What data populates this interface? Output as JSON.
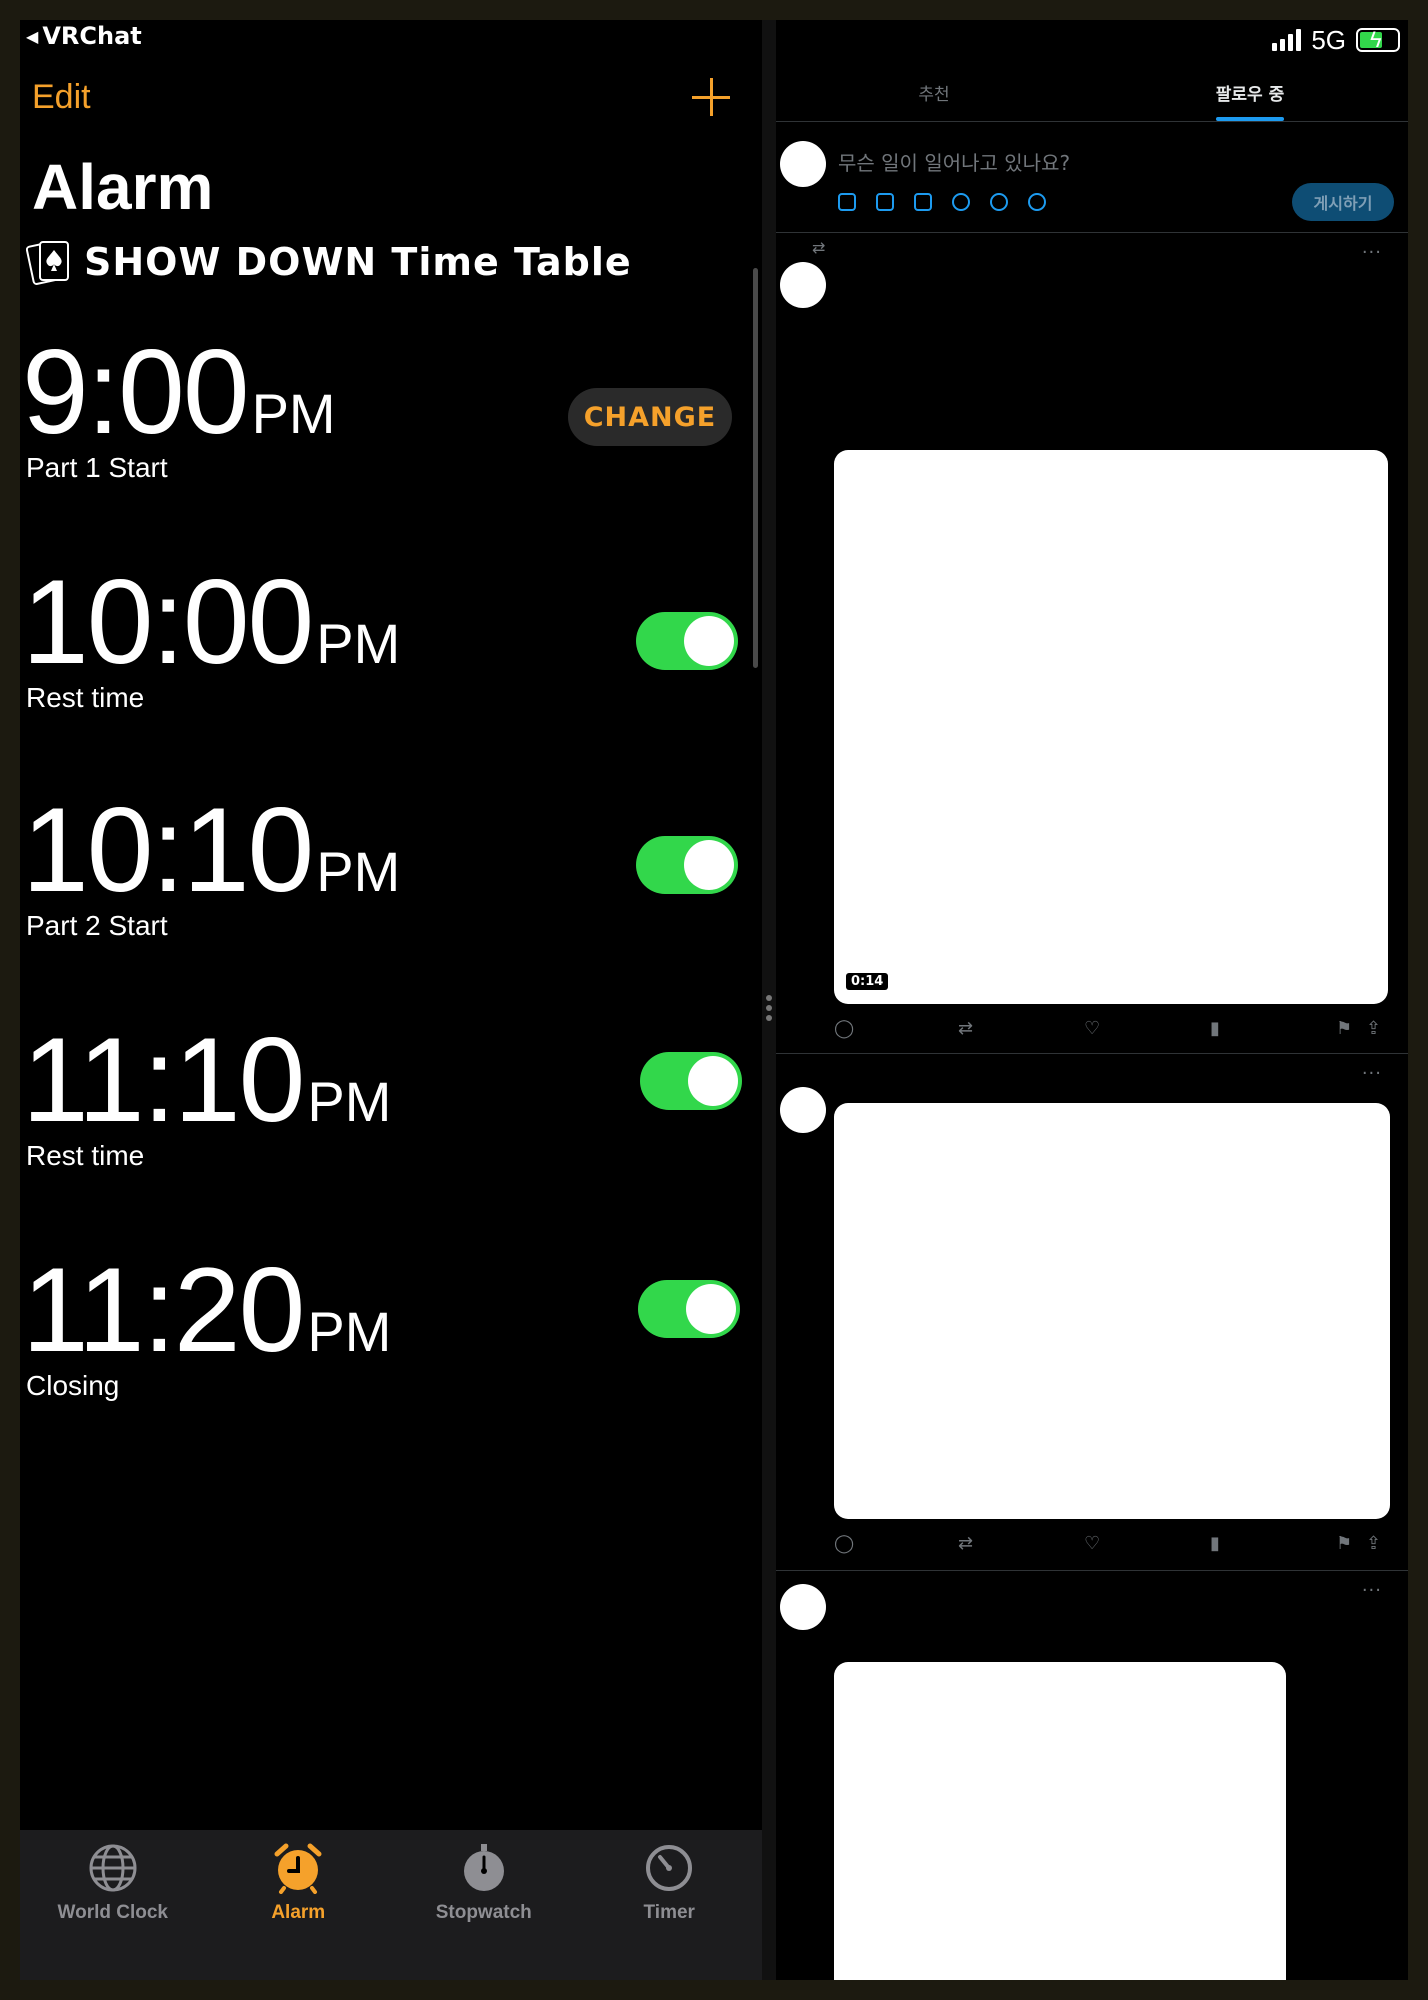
{
  "left_app": {
    "back_label": "VRChat",
    "edit_label": "Edit",
    "title": "Alarm",
    "section_title": "SHOW DOWN Time Table",
    "alarms": [
      {
        "time": "9:00",
        "ampm": "PM",
        "label": "Part 1 Start",
        "action": "CHANGE"
      },
      {
        "time": "10:00",
        "ampm": "PM",
        "label": "Rest time",
        "enabled": true
      },
      {
        "time": "10:10",
        "ampm": "PM",
        "label": "Part 2 Start",
        "enabled": true
      },
      {
        "time": "11:10",
        "ampm": "PM",
        "label": "Rest time",
        "enabled": true
      },
      {
        "time": "11:20",
        "ampm": "PM",
        "label": "Closing",
        "enabled": true
      }
    ],
    "tabs": [
      {
        "label": "World Clock",
        "icon": "globe-icon"
      },
      {
        "label": "Alarm",
        "icon": "alarm-clock-icon",
        "active": true
      },
      {
        "label": "Stopwatch",
        "icon": "stopwatch-icon"
      },
      {
        "label": "Timer",
        "icon": "timer-icon"
      }
    ],
    "accent_color": "#f5a12b",
    "toggle_color": "#32d74b"
  },
  "right_app": {
    "status": {
      "network": "5G"
    },
    "feed_tabs": [
      "추천",
      "팔로우 중"
    ],
    "active_tab": 1,
    "compose": {
      "placeholder": "무슨 일이 일어나고 있나요?",
      "post_label": "게시하기"
    },
    "tweets": [
      {
        "video_duration": "0:14"
      }
    ],
    "accent_color": "#1d9bf0"
  }
}
